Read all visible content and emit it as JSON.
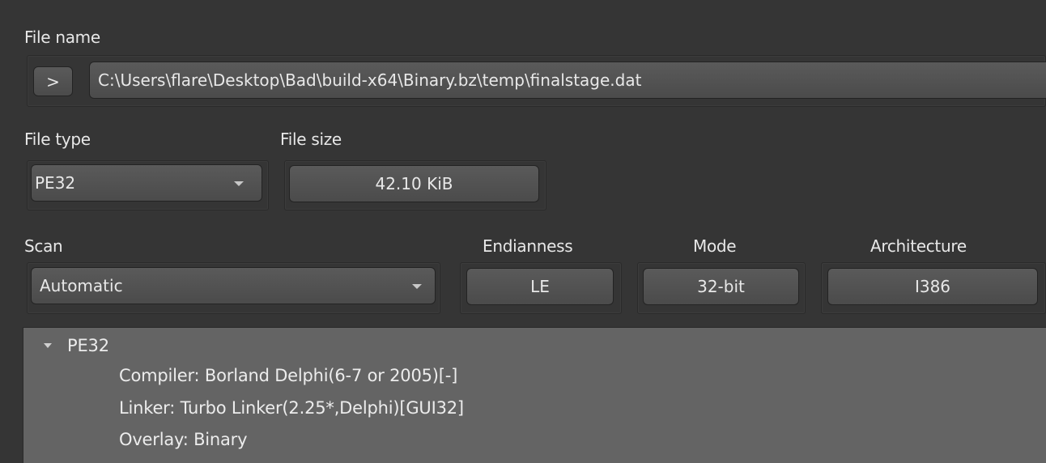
{
  "file_name": {
    "label": "File name",
    "browse_button": ">",
    "path": "C:\\Users\\flare\\Desktop\\Bad\\build-x64\\Binary.bz\\temp\\finalstage.dat"
  },
  "file_type": {
    "label": "File type",
    "selected": "PE32"
  },
  "file_size": {
    "label": "File size",
    "value": "42.10 KiB"
  },
  "scan": {
    "label": "Scan",
    "selected": "Automatic"
  },
  "endianness": {
    "label": "Endianness",
    "value": "LE"
  },
  "mode": {
    "label": "Mode",
    "value": "32-bit"
  },
  "architecture": {
    "label": "Architecture",
    "value": "I386"
  },
  "results": {
    "root": "PE32",
    "items": [
      "Compiler: Borland Delphi(6-7 or 2005)[-]",
      "Linker: Turbo Linker(2.25*,Delphi)[GUI32]",
      "Overlay: Binary"
    ]
  }
}
